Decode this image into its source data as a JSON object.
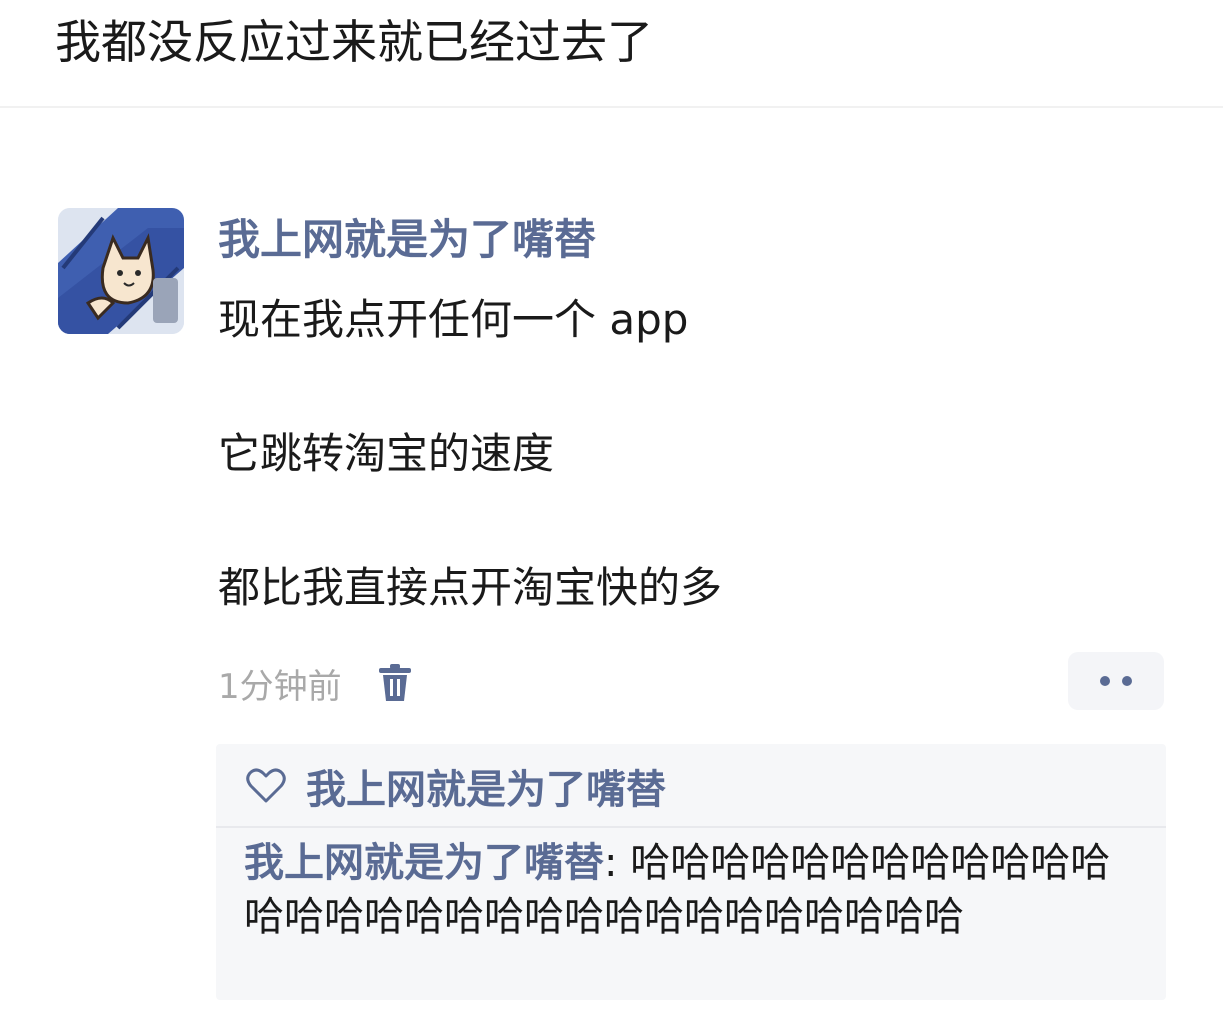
{
  "caption": "我都没反应过来就已经过去了",
  "post": {
    "username": "我上网就是为了嘴替",
    "lines": [
      "现在我点开任何一个 app",
      "它跳转淘宝的速度",
      "都比我直接点开淘宝快的多"
    ],
    "timestamp": "1分钟前",
    "icons": {
      "avatar": "cat-avatar",
      "delete": "trash-icon",
      "more": "more-dots-icon",
      "like": "heart-icon"
    }
  },
  "interactions": {
    "liker_name": "我上网就是为了嘴替",
    "comment": {
      "author": "我上网就是为了嘴替",
      "separator": ": ",
      "text": "哈哈哈哈哈哈哈哈哈哈哈哈哈哈哈哈哈哈哈哈哈哈哈哈哈哈哈哈哈哈"
    }
  },
  "colors": {
    "name_blue": "#5a6b94",
    "text": "#1a1a1a",
    "meta_gray": "#a9a9a9",
    "box_bg": "#f6f7f9"
  }
}
